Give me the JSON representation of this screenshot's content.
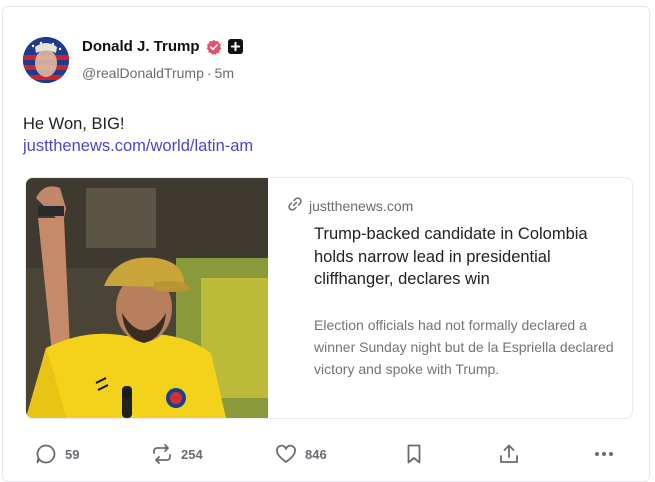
{
  "post": {
    "author": {
      "display_name": "Donald J. Trump",
      "handle": "@realDonaldTrump",
      "time": "5m",
      "separator": "·"
    },
    "text": "He Won, BIG!",
    "link": "justthenews.com/world/latin-am"
  },
  "preview": {
    "domain": "justthenews.com",
    "headline": "Trump-backed candidate in Colombia holds narrow lead in presidential cliffhanger, declares win",
    "summary": "Election officials had not formally declared a winner Sunday night but de la Espriella declared victory and spoke with Trump."
  },
  "actions": {
    "replies": "59",
    "reposts": "254",
    "likes": "846"
  },
  "colors": {
    "link": "#4b47c9",
    "verified": "#e2506a",
    "muted": "#6b6b73"
  },
  "icons": [
    "verified-badge-icon",
    "plus-badge-icon",
    "link-icon",
    "reply-icon",
    "repost-icon",
    "like-icon",
    "bookmark-icon",
    "share-icon",
    "more-icon"
  ]
}
